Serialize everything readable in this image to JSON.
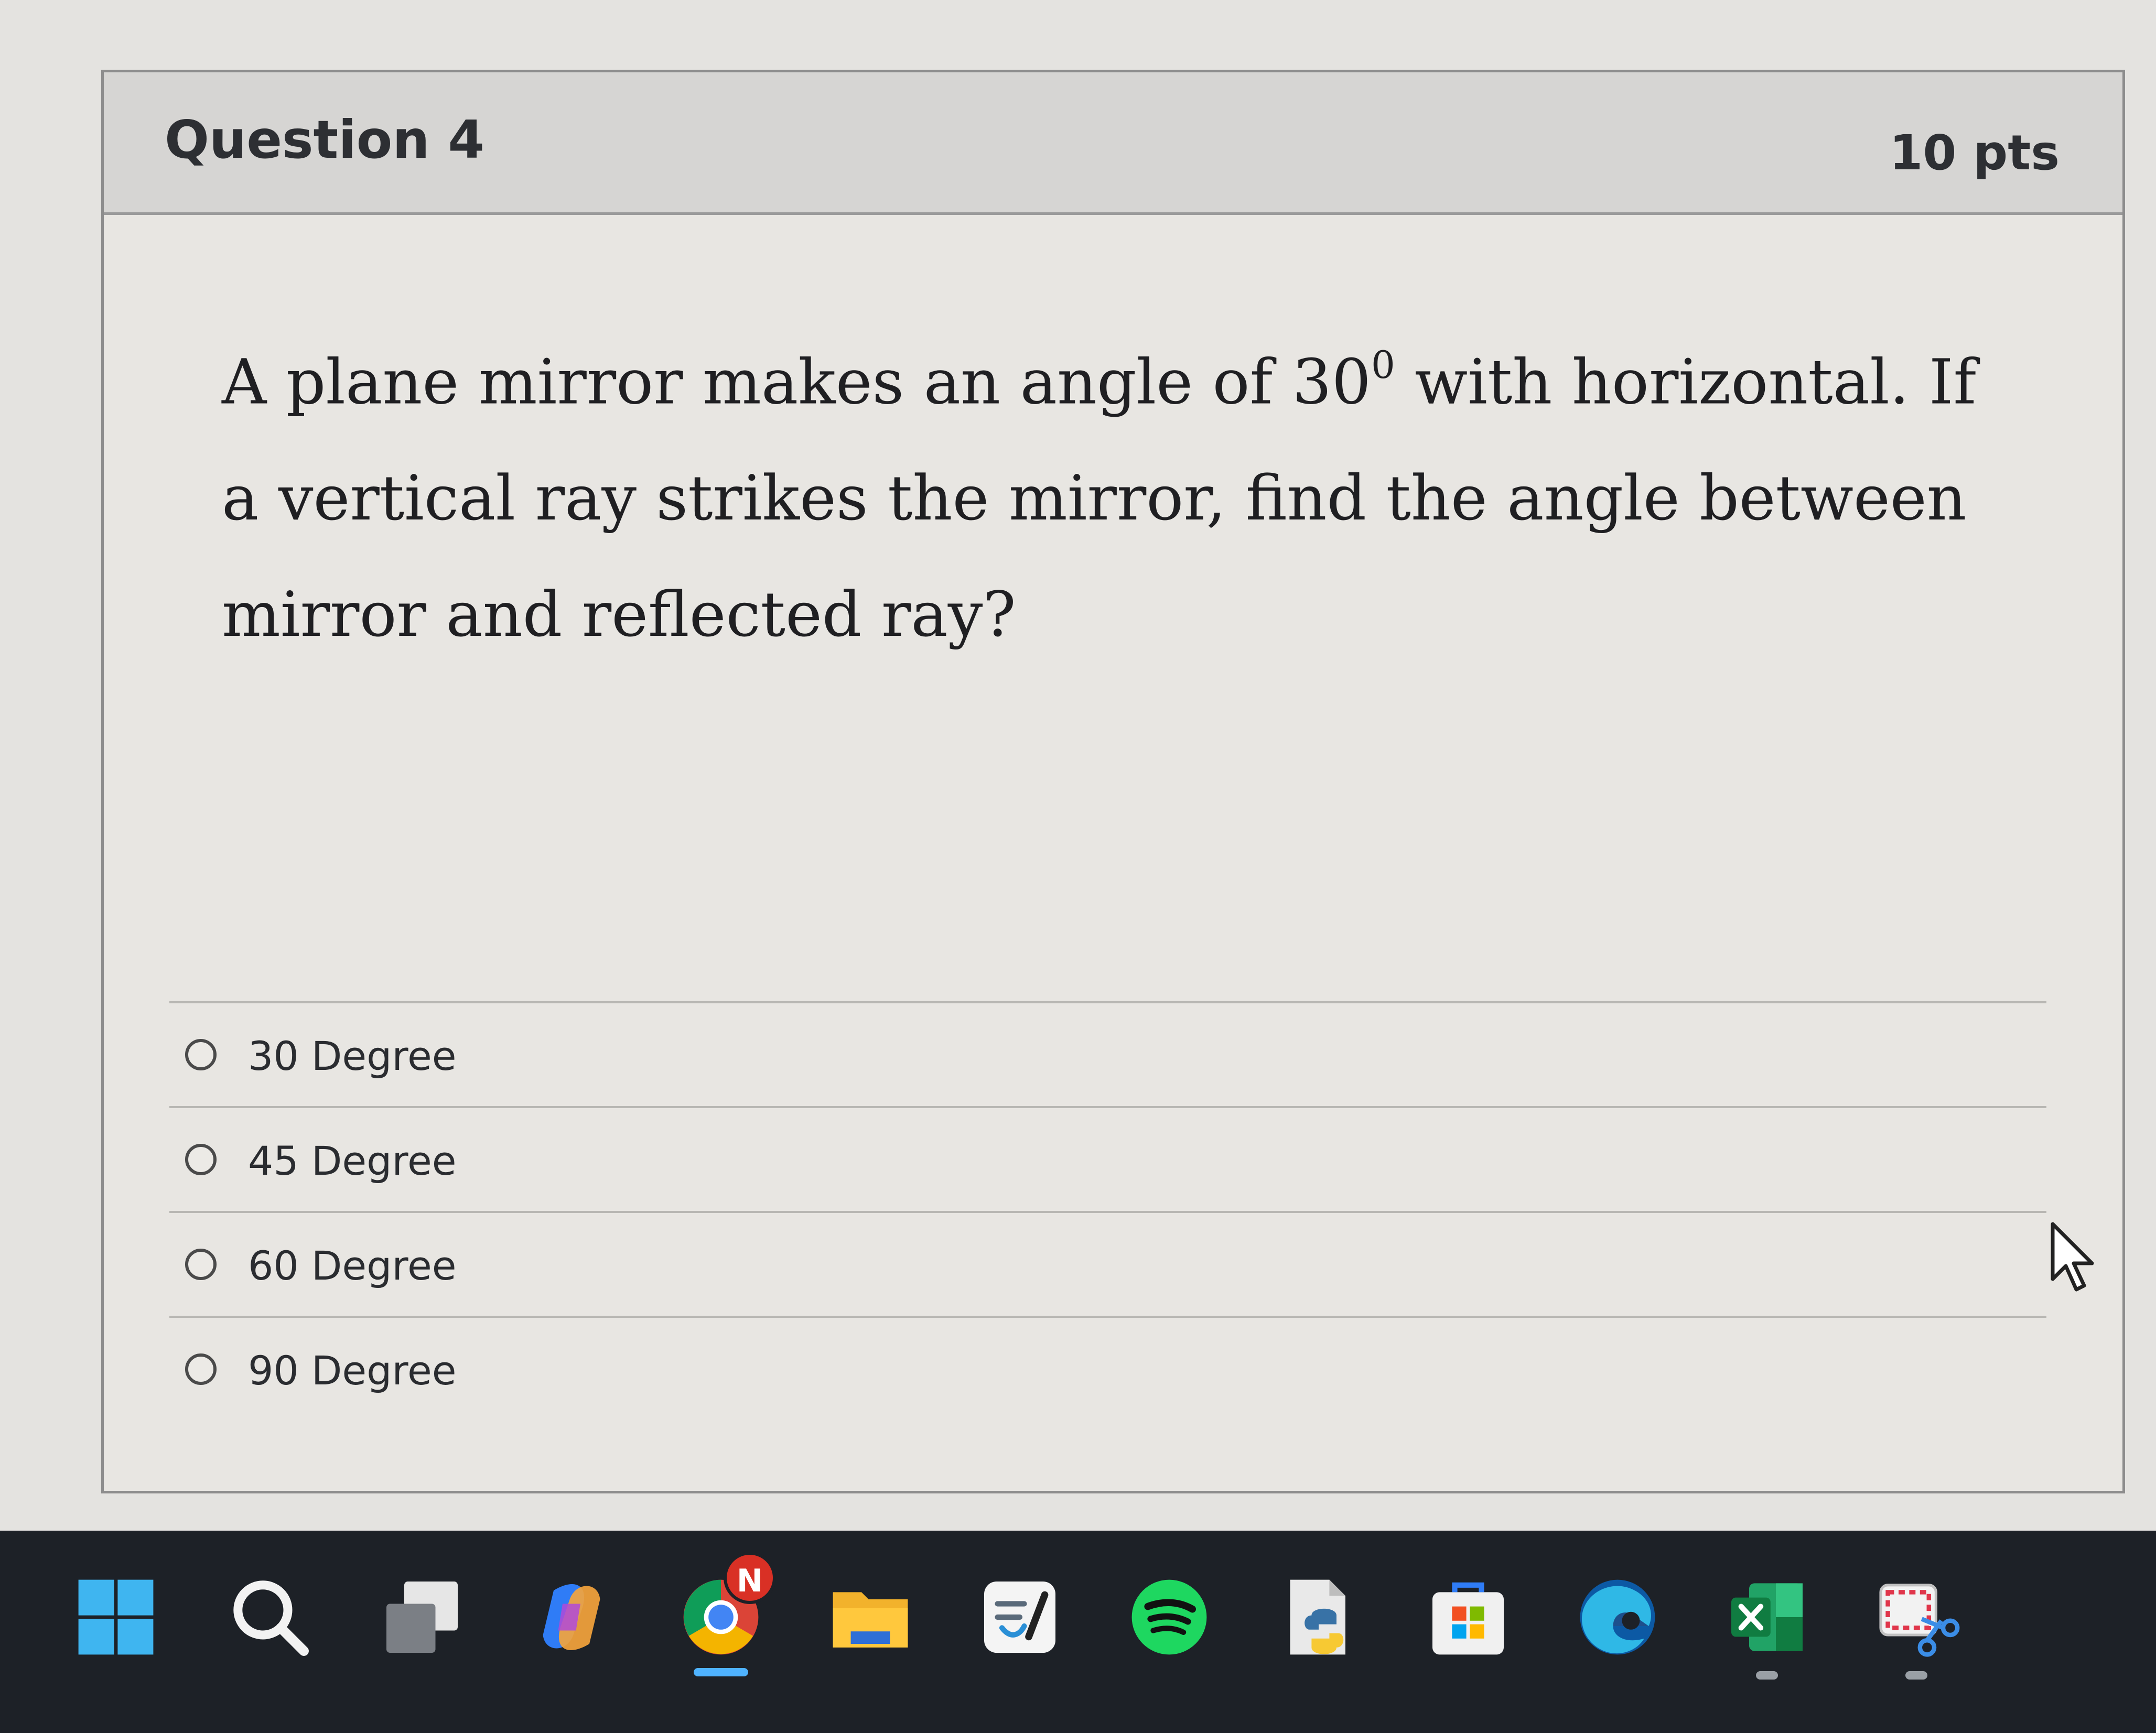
{
  "question": {
    "title": "Question 4",
    "points": "10 pts",
    "text_part1": "A plane mirror makes an angle of 30",
    "text_sup": "0",
    "text_part2": " with horizontal. If a vertical ray strikes the mirror, find the angle between mirror and reflected ray?"
  },
  "answers": [
    {
      "label": "30 Degree",
      "selected": false
    },
    {
      "label": "45 Degree",
      "selected": false
    },
    {
      "label": "60 Degree",
      "selected": false
    },
    {
      "label": "90 Degree",
      "selected": false
    }
  ],
  "taskbar": {
    "items": [
      {
        "name": "start",
        "icon": "windows-icon"
      },
      {
        "name": "search",
        "icon": "search-icon"
      },
      {
        "name": "task-view",
        "icon": "task-view-icon"
      },
      {
        "name": "copilot",
        "icon": "copilot-icon"
      },
      {
        "name": "chrome",
        "icon": "chrome-icon",
        "active": true,
        "badge": "N"
      },
      {
        "name": "file-explorer",
        "icon": "folder-icon"
      },
      {
        "name": "notes",
        "icon": "notes-icon"
      },
      {
        "name": "spotify",
        "icon": "spotify-icon"
      },
      {
        "name": "python-file",
        "icon": "python-icon"
      },
      {
        "name": "microsoft-store",
        "icon": "store-icon"
      },
      {
        "name": "edge",
        "icon": "edge-icon"
      },
      {
        "name": "excel",
        "icon": "excel-icon",
        "running": true
      },
      {
        "name": "snipping-tool",
        "icon": "snipping-tool-icon",
        "running": true
      }
    ]
  }
}
